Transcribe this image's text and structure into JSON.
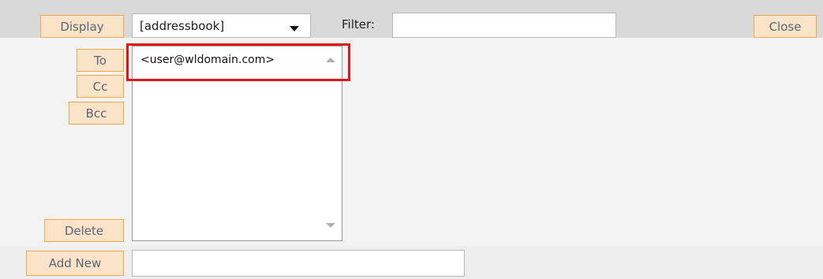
{
  "toolbar": {
    "display_label": "Display",
    "select_value": "[addressbook]",
    "filter_label": "Filter:",
    "filter_value": "",
    "close_label": "Close"
  },
  "recipients": {
    "to_label": "To",
    "cc_label": "Cc",
    "bcc_label": "Bcc",
    "delete_label": "Delete",
    "items": [
      "<user@wldomain.com>"
    ]
  },
  "footer": {
    "add_new_label": "Add New",
    "add_new_value": ""
  },
  "colors": {
    "button_bg": "#fbe3c7",
    "button_border": "#f5a54a",
    "highlight": "#e01818"
  }
}
